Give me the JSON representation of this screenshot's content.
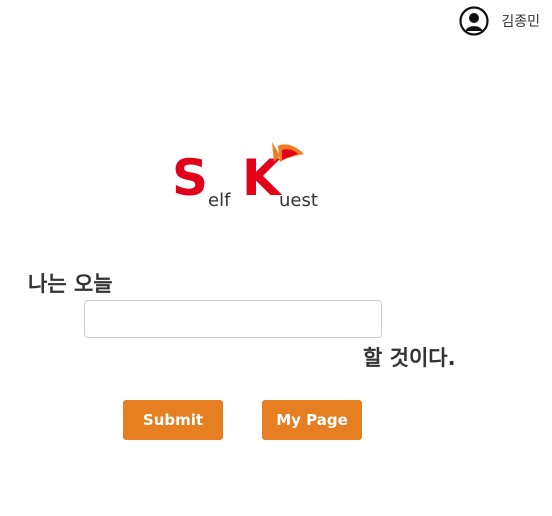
{
  "header": {
    "user_name": "김종민",
    "user_icon": "user-circle-icon"
  },
  "logo": {
    "letter_s": "S",
    "text_elf": "elf",
    "letter_k": "K",
    "text_uest": "uest",
    "brand_red": "#e2001a",
    "brand_orange": "#f47b20"
  },
  "form": {
    "prompt_before": "나는 오늘",
    "input_value": "",
    "input_placeholder": "",
    "prompt_after": "할 것이다.",
    "submit_label": "Submit",
    "mypage_label": "My Page"
  },
  "colors": {
    "button_bg": "#e67e22",
    "button_text": "#ffffff",
    "text": "#333333"
  }
}
